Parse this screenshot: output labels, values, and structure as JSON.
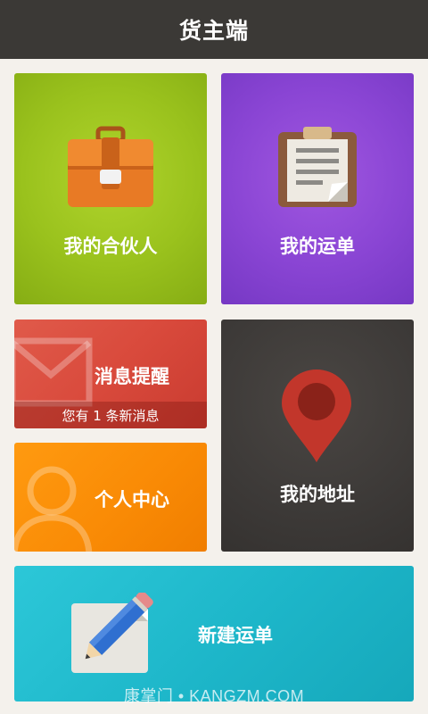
{
  "app": {
    "title": "货主端"
  },
  "tiles": {
    "partner": {
      "label": "我的合伙人",
      "icon": "briefcase-icon",
      "color": "#9ac21d"
    },
    "waybill": {
      "label": "我的运单",
      "icon": "clipboard-icon",
      "color": "#8a45d4"
    },
    "message": {
      "label": "消息提醒",
      "notice": "您有 1 条新消息",
      "icon": "envelope-icon",
      "color": "#d94a3c"
    },
    "personal": {
      "label": "个人中心",
      "icon": "person-icon",
      "color": "#f98a05"
    },
    "address": {
      "label": "我的地址",
      "icon": "map-pin-icon",
      "color": "#3d3a38"
    },
    "new_waybill": {
      "label": "新建运单",
      "icon": "pencil-note-icon",
      "color": "#1db6c9"
    }
  },
  "watermark": "康掌门 • KANGZM.COM"
}
